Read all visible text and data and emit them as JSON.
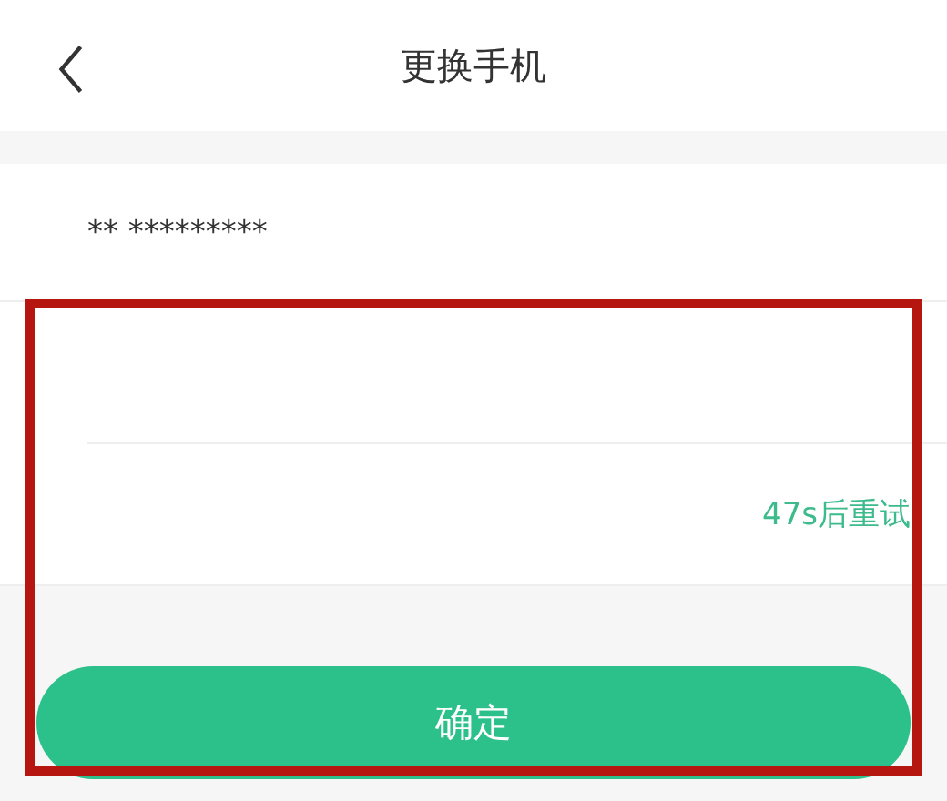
{
  "header": {
    "title": "更换手机"
  },
  "form": {
    "rows": [
      {
        "kind": "text",
        "value": "** *********"
      },
      {
        "kind": "input"
      },
      {
        "kind": "code",
        "action": "47s后重试"
      }
    ]
  },
  "confirm_button": "确定",
  "highlight": {
    "kind": "frame"
  }
}
